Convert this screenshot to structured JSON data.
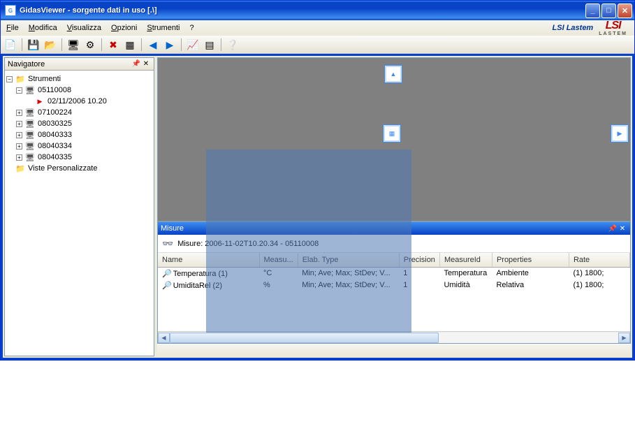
{
  "title": "GidasViewer - sorgente dati in uso  [.\\]",
  "menu": {
    "file": "File",
    "modifica": "Modifica",
    "visualizza": "Visualizza",
    "opzioni": "Opzioni",
    "strumenti": "Strumenti",
    "help": "?"
  },
  "brand": {
    "text": "LSI Lastem",
    "logo1": "LSI",
    "logo2": "LASTEM"
  },
  "navigator": {
    "title": "Navigatore",
    "root": "Strumenti",
    "items": [
      {
        "id": "05110008",
        "expanded": true,
        "children": [
          {
            "label": "02/11/2006 10.20",
            "type": "play"
          }
        ]
      },
      {
        "id": "07100224",
        "expanded": false
      },
      {
        "id": "08030325",
        "expanded": false
      },
      {
        "id": "08040333",
        "expanded": false
      },
      {
        "id": "08040334",
        "expanded": false
      },
      {
        "id": "08040335",
        "expanded": false
      }
    ],
    "custom": "Viste Personalizzate"
  },
  "misure": {
    "title": "Misure",
    "subtitle": "Misure: 2006-11-02T10.20.34 - 05110008",
    "columns": [
      "Name",
      "Measu...",
      "Elab. Type",
      "Precision",
      "MeasureId",
      "Properties",
      "Rate"
    ],
    "rows": [
      {
        "name": "Temperatura (1)",
        "unit": "°C",
        "elab": "Min; Ave; Max; StDev; V...",
        "prec": "1",
        "mid": "Temperatura",
        "prop": "Ambiente",
        "rate": "(1) 1800;"
      },
      {
        "name": "UmiditaRel (2)",
        "unit": "%",
        "elab": "Min; Ave; Max; StDev; V...",
        "prec": "1",
        "mid": "Umidità",
        "prop": "Relativa",
        "rate": "(1) 1800;"
      }
    ]
  }
}
